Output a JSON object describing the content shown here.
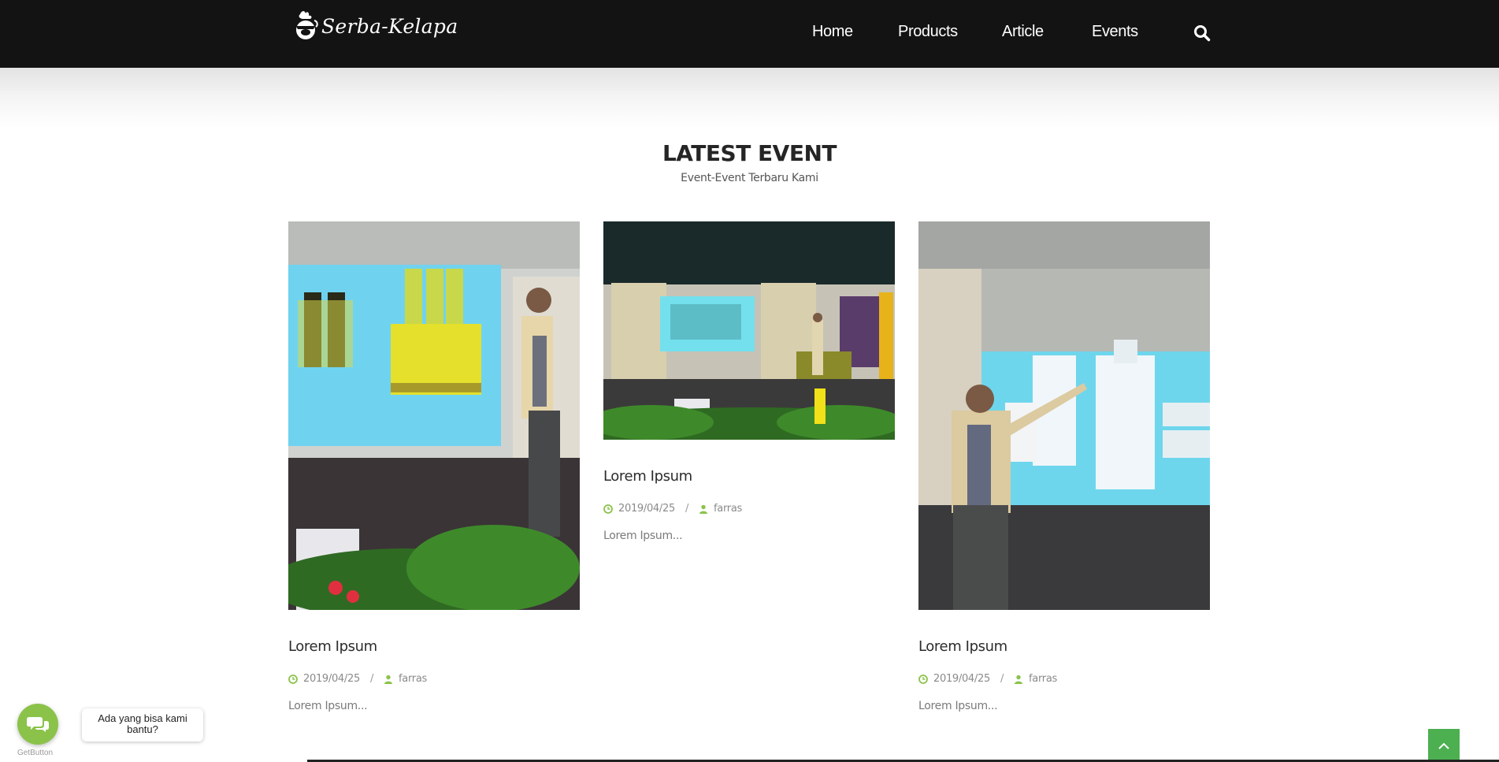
{
  "brand": {
    "name": "Serba-Kelapa"
  },
  "nav": {
    "items": [
      {
        "label": "Home"
      },
      {
        "label": "Products"
      },
      {
        "label": "Article"
      },
      {
        "label": "Events"
      }
    ],
    "search_icon": "search-icon"
  },
  "section": {
    "title": "LATEST EVENT",
    "subtitle": "Event-Event Terbaru Kami"
  },
  "events": [
    {
      "title": "Lorem Ipsum",
      "date": "2019/04/25",
      "author": "farras",
      "excerpt": "Lorem Ipsum..."
    },
    {
      "title": "Lorem Ipsum",
      "date": "2019/04/25",
      "author": "farras",
      "excerpt": "Lorem Ipsum..."
    },
    {
      "title": "Lorem Ipsum",
      "date": "2019/04/25",
      "author": "farras",
      "excerpt": "Lorem Ipsum..."
    }
  ],
  "meta_separator": "/",
  "chat": {
    "prompt": "Ada yang bisa kami bantu?",
    "credit": "GetButton"
  },
  "colors": {
    "nav_bg": "#131313",
    "accent_green": "#8bc34a",
    "back_to_top": "#4caf50"
  }
}
